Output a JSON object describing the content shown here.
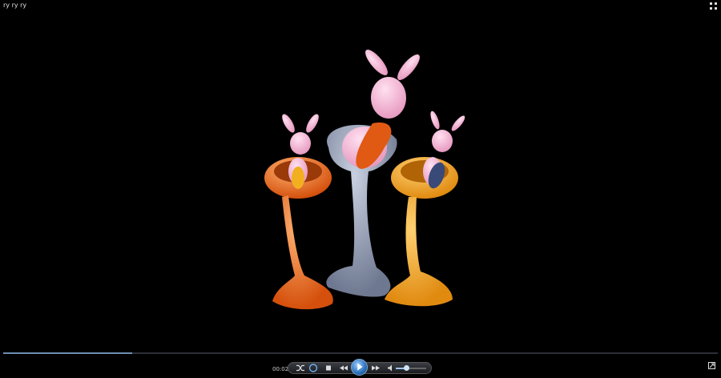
{
  "window": {
    "title": "ry ry ry"
  },
  "playback": {
    "time": "00:02",
    "progress": 0.18,
    "volume": 0.35
  },
  "icons": {
    "fullscreen": "fullscreen-icon",
    "shuffle": "shuffle-icon",
    "repeat": "repeat-icon",
    "stop": "stop-icon",
    "previous": "previous-icon",
    "play": "play-icon",
    "next": "next-icon",
    "mute": "speaker-icon",
    "switch": "switch-to-library-icon"
  },
  "colors": {
    "accent": "#6e8fb3",
    "background": "#000000"
  }
}
